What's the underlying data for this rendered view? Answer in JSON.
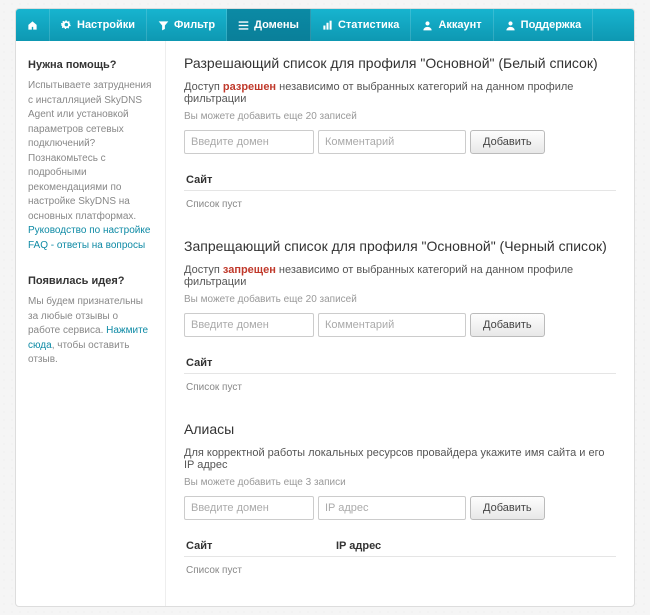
{
  "nav": {
    "settings": "Настройки",
    "filter": "Фильтр",
    "domains": "Домены",
    "stats": "Статистика",
    "account": "Аккаунт",
    "support": "Поддержка"
  },
  "sidebar": {
    "help_title": "Нужна помощь?",
    "help_text": "Испытываете затруднения с инсталляцией SkyDNS Agent или установкой параметров сетевых подключений? Познакомьтесь с подробными рекомендациями по настройке SkyDNS на основных платформах. ",
    "help_link1": "Руководство по настройке",
    "help_link2": "FAQ - ответы на вопросы",
    "idea_title": "Появилась идея?",
    "idea_text": "Мы будем признательны за любые отзывы о работе сервиса. ",
    "idea_link": "Нажмите сюда",
    "idea_tail": ", чтобы оставить отзыв."
  },
  "whitelist": {
    "title": "Разрешающий список для профиля \"Основной\" (Белый список)",
    "access_pre": "Доступ ",
    "access_word": "разрешен",
    "access_post": " независимо от выбранных категорий на данном профиле фильтрации",
    "hint": "Вы можете добавить еще 20 записей",
    "ph_domain": "Введите домен",
    "ph_comment": "Комментарий",
    "btn": "Добавить",
    "col_site": "Сайт",
    "empty": "Список пуст"
  },
  "blacklist": {
    "title": "Запрещающий список для профиля \"Основной\" (Черный список)",
    "access_pre": "Доступ ",
    "access_word": "запрещен",
    "access_post": " независимо от выбранных категорий на данном профиле фильтрации",
    "hint": "Вы можете добавить еще 20 записей",
    "ph_domain": "Введите домен",
    "ph_comment": "Комментарий",
    "btn": "Добавить",
    "col_site": "Сайт",
    "empty": "Список пуст"
  },
  "aliases": {
    "title": "Алиасы",
    "desc": "Для корректной работы локальных ресурсов провайдера укажите имя сайта и его IP адрес",
    "hint": "Вы можете добавить еще 3 записи",
    "ph_domain": "Введите домен",
    "ph_ip": "IP адрес",
    "btn": "Добавить",
    "col_site": "Сайт",
    "col_ip": "IP адрес",
    "empty": "Список пуст"
  }
}
